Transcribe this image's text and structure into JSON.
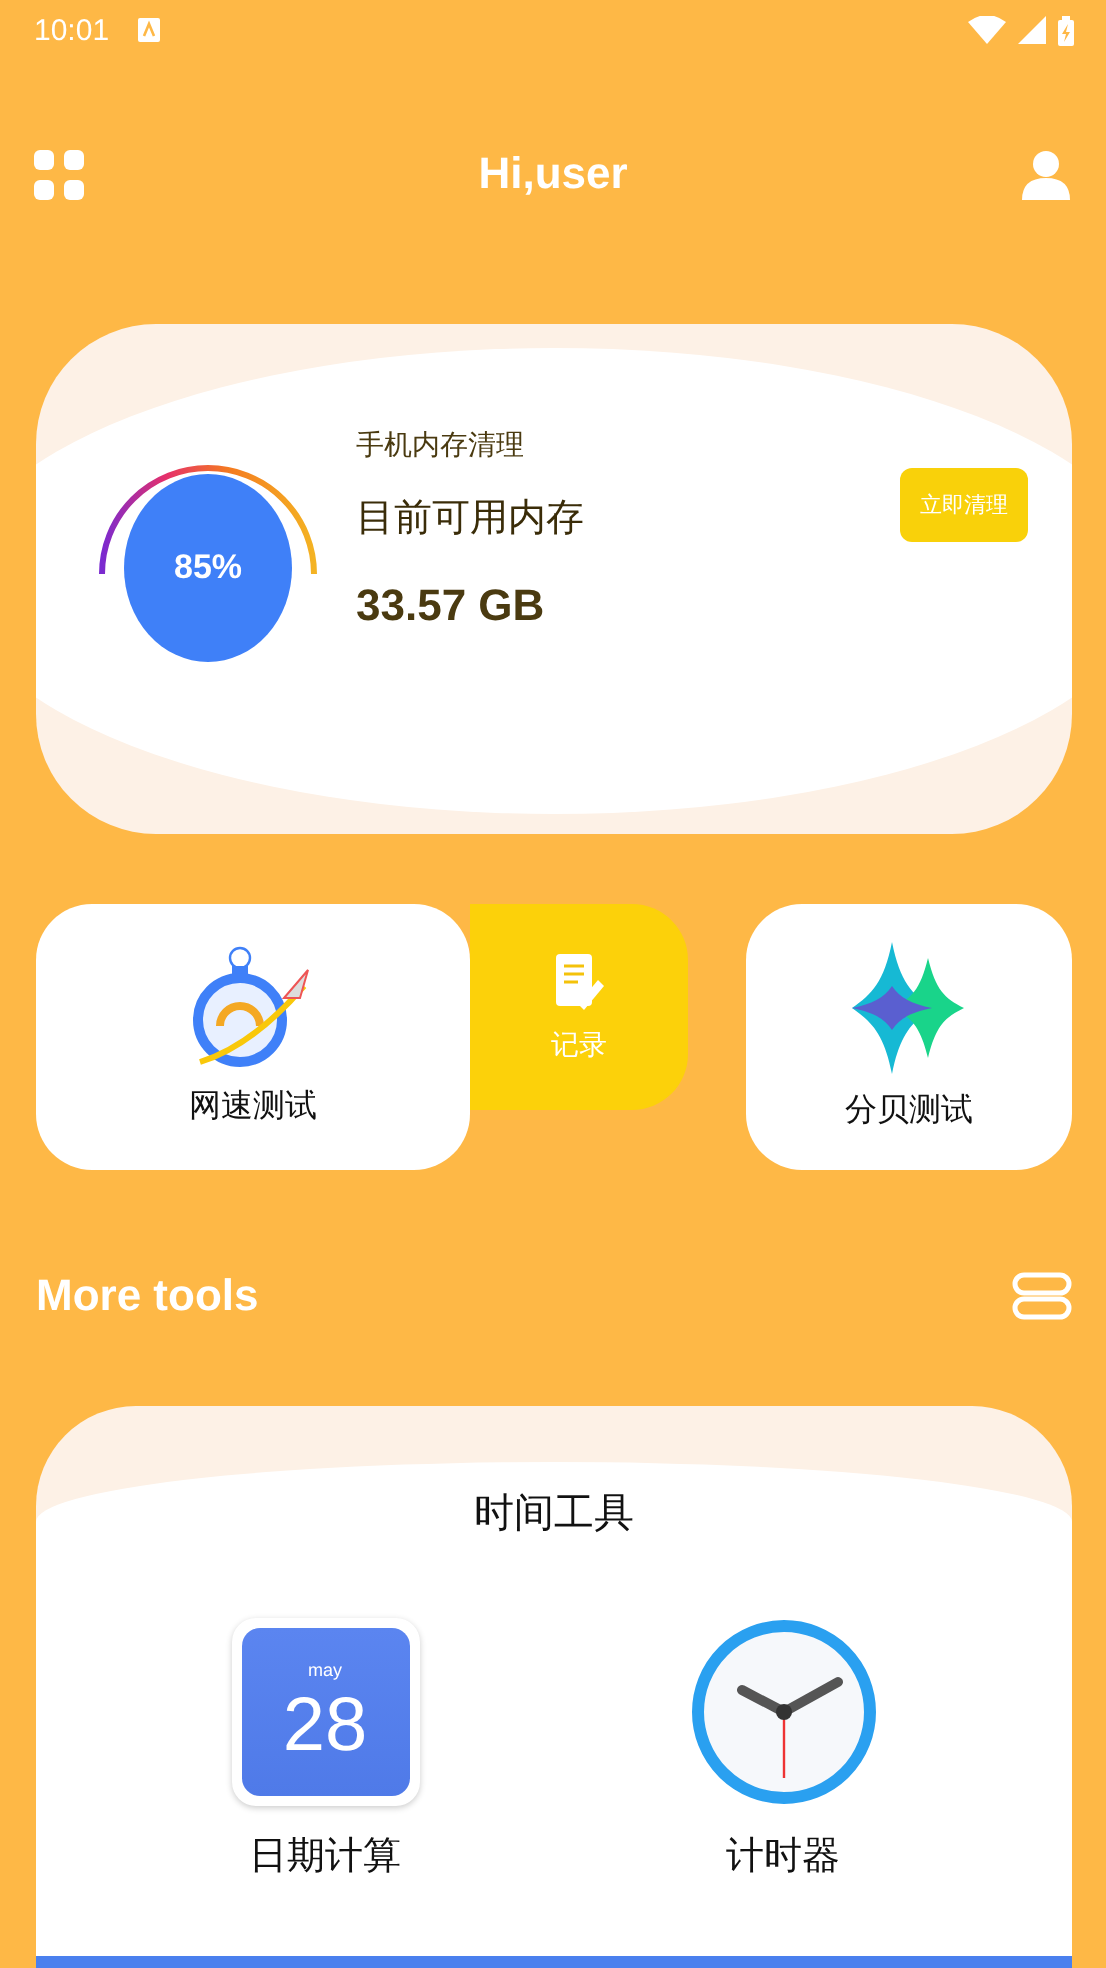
{
  "status_bar": {
    "time": "10:01"
  },
  "header": {
    "title": "Hi,user"
  },
  "memory_card": {
    "percent": "85%",
    "caption": "手机内存清理",
    "label": "目前可用内存",
    "value": "33.57 GB",
    "button": "立即清理"
  },
  "tools": [
    {
      "kind": "speed",
      "label": "网速测试"
    },
    {
      "kind": "record",
      "label": "记录"
    },
    {
      "kind": "decibel",
      "label": "分贝测试"
    }
  ],
  "more_tools": {
    "title": "More tools"
  },
  "time_tools": {
    "title": "时间工具",
    "items": [
      {
        "kind": "calendar",
        "label": "日期计算",
        "month": "may",
        "day": "28"
      },
      {
        "kind": "clock",
        "label": "计时器"
      }
    ]
  }
}
